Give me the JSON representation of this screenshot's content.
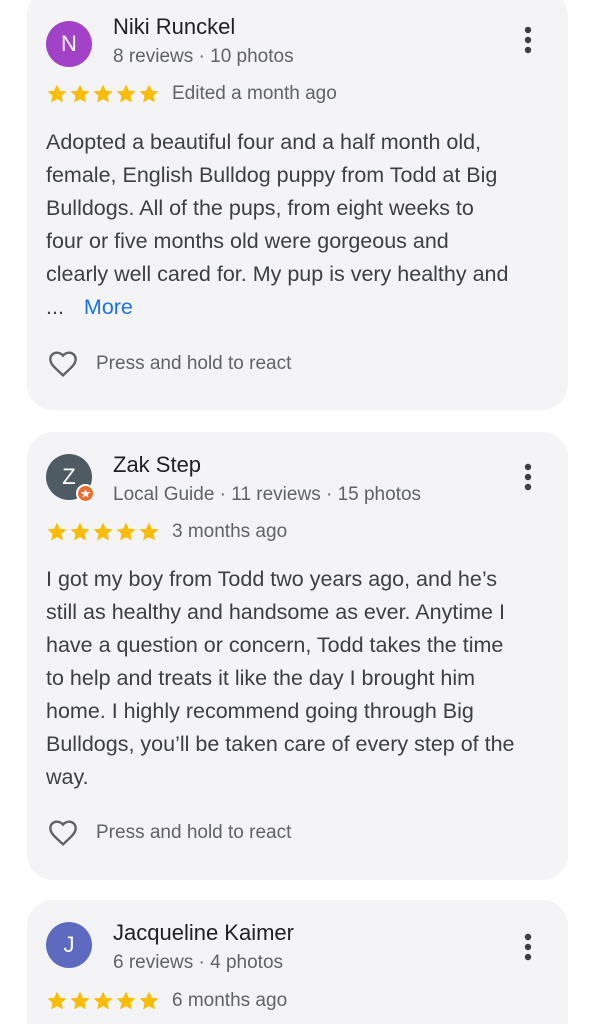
{
  "reviews": [
    {
      "avatar_letter": "N",
      "avatar_color": "#a142c9",
      "name": "Niki Runckel",
      "meta": "8 reviews · 10 photos",
      "rating": 5,
      "date": "Edited a month ago",
      "text_lines": [
        "Adopted a beautiful four and a half month old,",
        "female, English Bulldog puppy from Todd at Big",
        "Bulldogs. All of the pups, from eight weeks to",
        "four or five months old were gorgeous and",
        "clearly well cared for. My pup is very healthy and"
      ],
      "ellipsis": "...",
      "more_label": "More",
      "react_label": "Press and hold to react"
    },
    {
      "avatar_letter": "Z",
      "avatar_color": "#4f5b62",
      "local_guide_badge": true,
      "name": "Zak Step",
      "meta": "Local Guide · 11 reviews · 15 photos",
      "rating": 5,
      "date": "3 months ago",
      "text_lines": [
        "I got my boy from Todd two years ago, and he’s",
        "still as healthy and handsome as ever. Anytime I",
        "have a question or concern, Todd takes the time",
        "to help and treats it like the day I brought him",
        "home. I highly recommend going through Big",
        "Bulldogs, you’ll be taken care of every step of the",
        "way."
      ],
      "react_label": "Press and hold to react"
    },
    {
      "avatar_letter": "J",
      "avatar_color": "#5c6bc0",
      "name": "Jacqueline Kaimer",
      "meta": "6 reviews · 4 photos",
      "rating": 5,
      "date": "6 months ago"
    }
  ],
  "colors": {
    "star": "#fbbc04",
    "card_bg": "#f4f4f6",
    "link": "#1a73e8",
    "badge": "#f26b2a"
  },
  "icons": {
    "menu": "more-vert-icon",
    "react": "heart-outline-icon",
    "star": "star-filled-icon",
    "badge": "local-guide-badge-icon"
  }
}
